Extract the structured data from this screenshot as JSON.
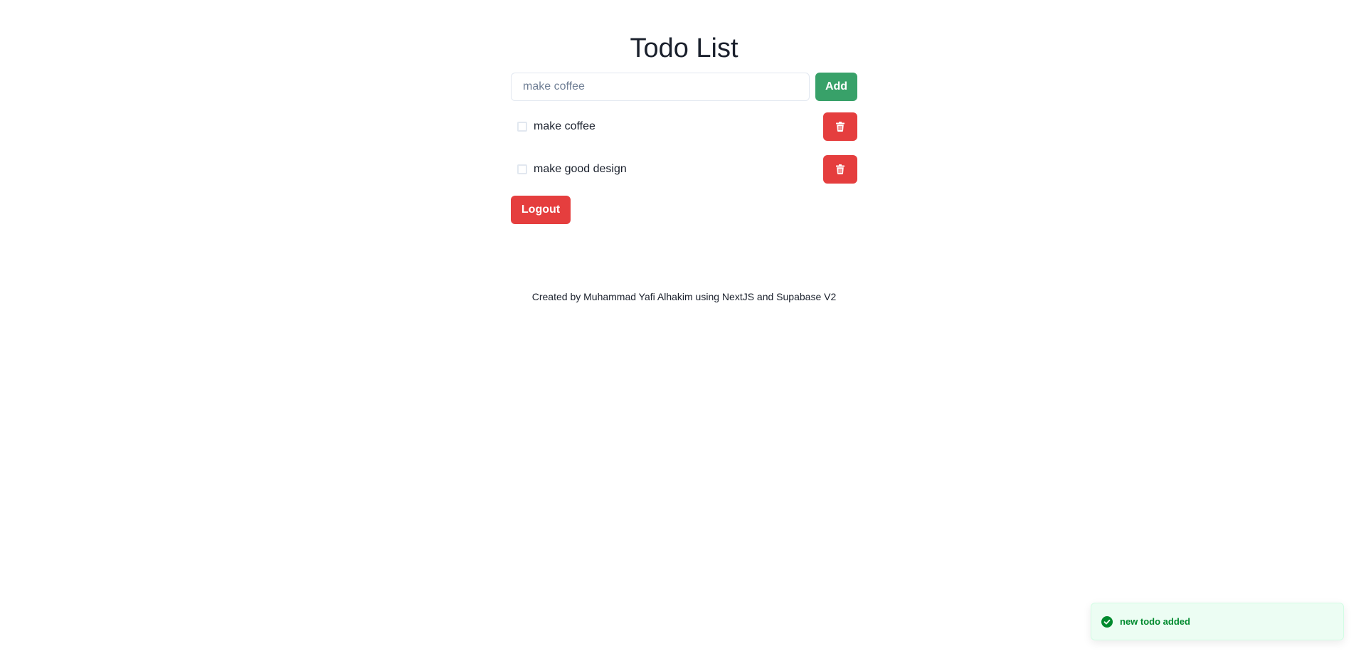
{
  "header": {
    "title": "Todo List"
  },
  "add_form": {
    "input_value": "",
    "input_placeholder": "make coffee",
    "add_label": "Add"
  },
  "todos": [
    {
      "label": "make coffee",
      "checked": false,
      "delete_icon": "trash-icon"
    },
    {
      "label": "make good design",
      "checked": false,
      "delete_icon": "trash-icon"
    }
  ],
  "logout_label": "Logout",
  "footer": {
    "text": "Created by Muhammad Yafi Alhakim using NextJS and Supabase V2"
  },
  "toast": {
    "message": "new todo added",
    "icon": "check-circle-icon"
  },
  "colors": {
    "add_button": "#38a169",
    "delete_button": "#e53e3e",
    "logout_button": "#e53e3e",
    "toast_background": "#ecfdf3",
    "toast_text": "#008a2e"
  }
}
